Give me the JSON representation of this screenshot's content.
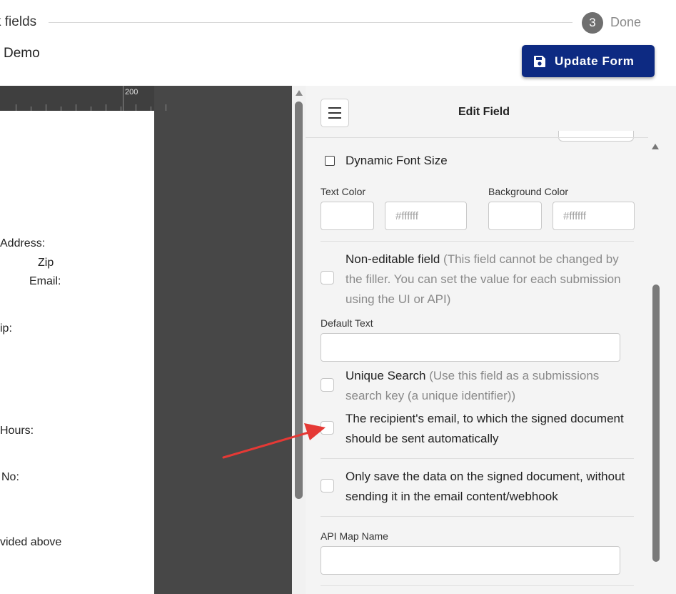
{
  "stepper": {
    "current_label": "k fields",
    "step_number": "3",
    "step_label": "Done"
  },
  "form_title": "Demo",
  "update_button": {
    "label": "Update Form",
    "accent": "#0d2a82"
  },
  "document": {
    "ruler_mark": "200",
    "labels": [
      "Address:",
      "Zip",
      "Email:",
      "ip:",
      "Hours:",
      "No:",
      "vided above"
    ]
  },
  "panel": {
    "title": "Edit Field",
    "dynamic_font_size": {
      "label": "Dynamic Font Size",
      "checked": false
    },
    "text_color": {
      "label": "Text Color",
      "value": "",
      "placeholder": "#ffffff"
    },
    "background_color": {
      "label": "Background Color",
      "value": "",
      "placeholder": "#ffffff"
    },
    "non_editable": {
      "label": "Non-editable field",
      "hint": "(This field cannot be changed by the filler. You can set the value for each submission using the UI or API)",
      "checked": false
    },
    "default_text": {
      "label": "Default Text",
      "value": ""
    },
    "unique_search": {
      "label": "Unique Search",
      "hint": "(Use this field as a submissions search key (a unique identifier))",
      "checked": false
    },
    "recipient_email": {
      "label": "The recipient's email, to which the signed document should be sent automatically",
      "checked": false
    },
    "only_save": {
      "label": "Only save the data on the signed document, without sending it in the email content/webhook",
      "checked": false
    },
    "api_map_name": {
      "label": "API Map Name",
      "value": ""
    }
  },
  "annotation": {
    "arrow_color": "#e53935"
  }
}
